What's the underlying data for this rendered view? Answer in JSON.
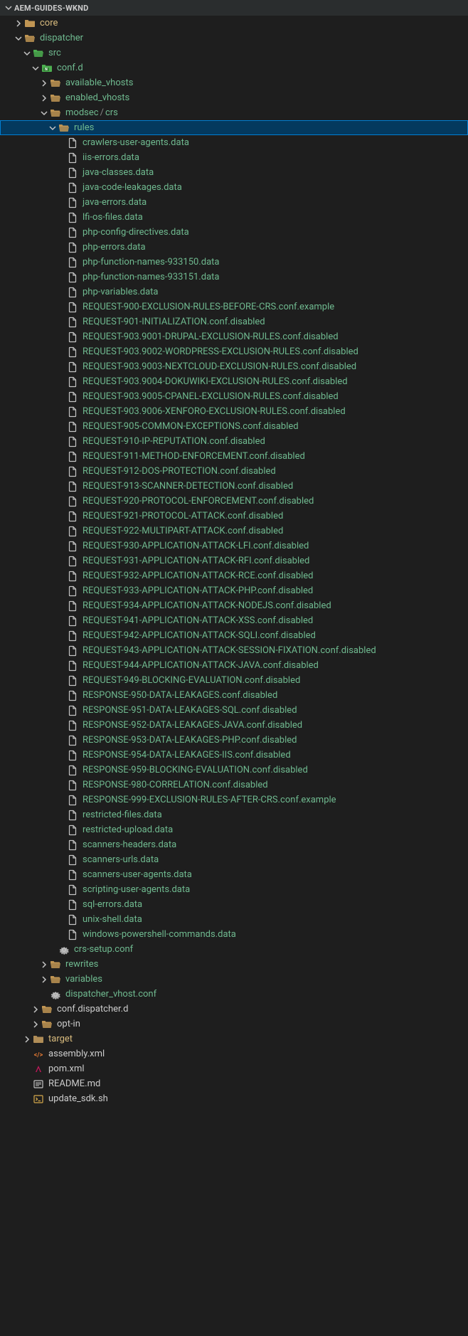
{
  "header": "AEM-GUIDES-WKND",
  "tree": [
    {
      "depth": 0,
      "type": "header",
      "chev": "down",
      "label": "AEM-GUIDES-WKND"
    },
    {
      "depth": 1,
      "type": "folder-plain",
      "chev": "right",
      "label": "core",
      "labelClass": "yellow"
    },
    {
      "depth": 1,
      "type": "folder-open",
      "chev": "down",
      "label": "dispatcher"
    },
    {
      "depth": 2,
      "type": "folder-green",
      "chev": "down",
      "label": "src"
    },
    {
      "depth": 3,
      "type": "folder-green-badge",
      "chev": "down",
      "label": "conf.d"
    },
    {
      "depth": 4,
      "type": "folder-open",
      "chev": "right",
      "label": "available_vhosts"
    },
    {
      "depth": 4,
      "type": "folder-open",
      "chev": "right",
      "label": "enabled_vhosts"
    },
    {
      "depth": 4,
      "type": "folder-open-path",
      "chev": "down",
      "label": "modsec",
      "path2": "crs"
    },
    {
      "depth": 5,
      "type": "folder-open",
      "chev": "down",
      "label": "rules",
      "selected": true
    },
    {
      "depth": 6,
      "type": "file",
      "label": "crawlers-user-agents.data"
    },
    {
      "depth": 6,
      "type": "file",
      "label": "iis-errors.data"
    },
    {
      "depth": 6,
      "type": "file",
      "label": "java-classes.data"
    },
    {
      "depth": 6,
      "type": "file",
      "label": "java-code-leakages.data"
    },
    {
      "depth": 6,
      "type": "file",
      "label": "java-errors.data"
    },
    {
      "depth": 6,
      "type": "file",
      "label": "lfi-os-files.data"
    },
    {
      "depth": 6,
      "type": "file",
      "label": "php-config-directives.data"
    },
    {
      "depth": 6,
      "type": "file",
      "label": "php-errors.data"
    },
    {
      "depth": 6,
      "type": "file",
      "label": "php-function-names-933150.data"
    },
    {
      "depth": 6,
      "type": "file",
      "label": "php-function-names-933151.data"
    },
    {
      "depth": 6,
      "type": "file",
      "label": "php-variables.data"
    },
    {
      "depth": 6,
      "type": "file",
      "label": "REQUEST-900-EXCLUSION-RULES-BEFORE-CRS.conf.example"
    },
    {
      "depth": 6,
      "type": "file",
      "label": "REQUEST-901-INITIALIZATION.conf.disabled"
    },
    {
      "depth": 6,
      "type": "file",
      "label": "REQUEST-903.9001-DRUPAL-EXCLUSION-RULES.conf.disabled"
    },
    {
      "depth": 6,
      "type": "file",
      "label": "REQUEST-903.9002-WORDPRESS-EXCLUSION-RULES.conf.disabled"
    },
    {
      "depth": 6,
      "type": "file",
      "label": "REQUEST-903.9003-NEXTCLOUD-EXCLUSION-RULES.conf.disabled"
    },
    {
      "depth": 6,
      "type": "file",
      "label": "REQUEST-903.9004-DOKUWIKI-EXCLUSION-RULES.conf.disabled"
    },
    {
      "depth": 6,
      "type": "file",
      "label": "REQUEST-903.9005-CPANEL-EXCLUSION-RULES.conf.disabled"
    },
    {
      "depth": 6,
      "type": "file",
      "label": "REQUEST-903.9006-XENFORO-EXCLUSION-RULES.conf.disabled"
    },
    {
      "depth": 6,
      "type": "file",
      "label": "REQUEST-905-COMMON-EXCEPTIONS.conf.disabled"
    },
    {
      "depth": 6,
      "type": "file",
      "label": "REQUEST-910-IP-REPUTATION.conf.disabled"
    },
    {
      "depth": 6,
      "type": "file",
      "label": "REQUEST-911-METHOD-ENFORCEMENT.conf.disabled"
    },
    {
      "depth": 6,
      "type": "file",
      "label": "REQUEST-912-DOS-PROTECTION.conf.disabled"
    },
    {
      "depth": 6,
      "type": "file",
      "label": "REQUEST-913-SCANNER-DETECTION.conf.disabled"
    },
    {
      "depth": 6,
      "type": "file",
      "label": "REQUEST-920-PROTOCOL-ENFORCEMENT.conf.disabled"
    },
    {
      "depth": 6,
      "type": "file",
      "label": "REQUEST-921-PROTOCOL-ATTACK.conf.disabled"
    },
    {
      "depth": 6,
      "type": "file",
      "label": "REQUEST-922-MULTIPART-ATTACK.conf.disabled"
    },
    {
      "depth": 6,
      "type": "file",
      "label": "REQUEST-930-APPLICATION-ATTACK-LFI.conf.disabled"
    },
    {
      "depth": 6,
      "type": "file",
      "label": "REQUEST-931-APPLICATION-ATTACK-RFI.conf.disabled"
    },
    {
      "depth": 6,
      "type": "file",
      "label": "REQUEST-932-APPLICATION-ATTACK-RCE.conf.disabled"
    },
    {
      "depth": 6,
      "type": "file",
      "label": "REQUEST-933-APPLICATION-ATTACK-PHP.conf.disabled"
    },
    {
      "depth": 6,
      "type": "file",
      "label": "REQUEST-934-APPLICATION-ATTACK-NODEJS.conf.disabled"
    },
    {
      "depth": 6,
      "type": "file",
      "label": "REQUEST-941-APPLICATION-ATTACK-XSS.conf.disabled"
    },
    {
      "depth": 6,
      "type": "file",
      "label": "REQUEST-942-APPLICATION-ATTACK-SQLI.conf.disabled"
    },
    {
      "depth": 6,
      "type": "file",
      "label": "REQUEST-943-APPLICATION-ATTACK-SESSION-FIXATION.conf.disabled"
    },
    {
      "depth": 6,
      "type": "file",
      "label": "REQUEST-944-APPLICATION-ATTACK-JAVA.conf.disabled"
    },
    {
      "depth": 6,
      "type": "file",
      "label": "REQUEST-949-BLOCKING-EVALUATION.conf.disabled"
    },
    {
      "depth": 6,
      "type": "file",
      "label": "RESPONSE-950-DATA-LEAKAGES.conf.disabled"
    },
    {
      "depth": 6,
      "type": "file",
      "label": "RESPONSE-951-DATA-LEAKAGES-SQL.conf.disabled"
    },
    {
      "depth": 6,
      "type": "file",
      "label": "RESPONSE-952-DATA-LEAKAGES-JAVA.conf.disabled"
    },
    {
      "depth": 6,
      "type": "file",
      "label": "RESPONSE-953-DATA-LEAKAGES-PHP.conf.disabled"
    },
    {
      "depth": 6,
      "type": "file",
      "label": "RESPONSE-954-DATA-LEAKAGES-IIS.conf.disabled"
    },
    {
      "depth": 6,
      "type": "file",
      "label": "RESPONSE-959-BLOCKING-EVALUATION.conf.disabled"
    },
    {
      "depth": 6,
      "type": "file",
      "label": "RESPONSE-980-CORRELATION.conf.disabled"
    },
    {
      "depth": 6,
      "type": "file",
      "label": "RESPONSE-999-EXCLUSION-RULES-AFTER-CRS.conf.example"
    },
    {
      "depth": 6,
      "type": "file",
      "label": "restricted-files.data"
    },
    {
      "depth": 6,
      "type": "file",
      "label": "restricted-upload.data"
    },
    {
      "depth": 6,
      "type": "file",
      "label": "scanners-headers.data"
    },
    {
      "depth": 6,
      "type": "file",
      "label": "scanners-urls.data"
    },
    {
      "depth": 6,
      "type": "file",
      "label": "scanners-user-agents.data"
    },
    {
      "depth": 6,
      "type": "file",
      "label": "scripting-user-agents.data"
    },
    {
      "depth": 6,
      "type": "file",
      "label": "sql-errors.data"
    },
    {
      "depth": 6,
      "type": "file",
      "label": "unix-shell.data"
    },
    {
      "depth": 6,
      "type": "file",
      "label": "windows-powershell-commands.data"
    },
    {
      "depth": 5,
      "type": "gear",
      "label": "crs-setup.conf"
    },
    {
      "depth": 4,
      "type": "folder-open",
      "chev": "right",
      "label": "rewrites"
    },
    {
      "depth": 4,
      "type": "folder-open",
      "chev": "right",
      "label": "variables"
    },
    {
      "depth": 4,
      "type": "gear",
      "label": "dispatcher_vhost.conf"
    },
    {
      "depth": 3,
      "type": "folder-open",
      "chev": "right",
      "label": "conf.dispatcher.d",
      "labelClass": "muted"
    },
    {
      "depth": 3,
      "type": "folder-open",
      "chev": "right",
      "label": "opt-in",
      "labelClass": "muted"
    },
    {
      "depth": 2,
      "type": "folder-tan",
      "chev": "right",
      "label": "target",
      "labelClass": "yellow"
    },
    {
      "depth": 2,
      "type": "xml",
      "label": "assembly.xml",
      "labelClass": "muted"
    },
    {
      "depth": 2,
      "type": "maven",
      "label": "pom.xml",
      "labelClass": "muted"
    },
    {
      "depth": 2,
      "type": "readme",
      "label": "README.md",
      "labelClass": "muted"
    },
    {
      "depth": 2,
      "type": "shell",
      "label": "update_sdk.sh",
      "labelClass": "muted"
    }
  ]
}
